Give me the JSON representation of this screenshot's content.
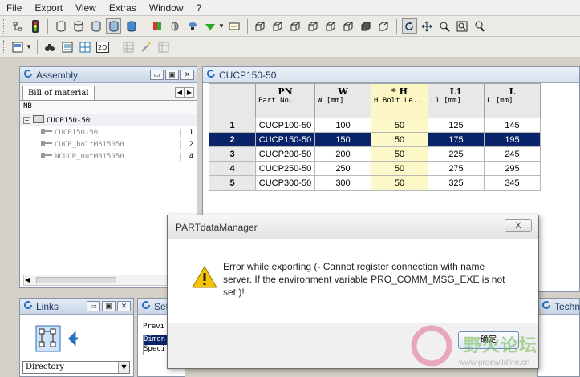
{
  "menubar": {
    "items": [
      "File",
      "Export",
      "View",
      "Extras",
      "Window",
      "?"
    ]
  },
  "assembly": {
    "title": "Assembly",
    "tab": "Bill of material",
    "column_header": "NB",
    "root": "CUCP150-50",
    "items": [
      {
        "name": "CUCP150-50",
        "qty": "1"
      },
      {
        "name": "CUCP_boltM815050",
        "qty": "2"
      },
      {
        "name": "NCUCP_nutM815050",
        "qty": "4"
      }
    ]
  },
  "table_window": {
    "title": "CUCP150-50",
    "columns": [
      {
        "top": "PN",
        "sub": "Part No."
      },
      {
        "top": "W",
        "sub": "W [mm]"
      },
      {
        "top": "* H",
        "sub": "H Bolt Le..."
      },
      {
        "top": "L1",
        "sub": "L1 [mm]"
      },
      {
        "top": "L",
        "sub": "L [mm]"
      }
    ],
    "rows": [
      {
        "no": "1",
        "cells": [
          "CUCP100-50",
          "100",
          "50",
          "125",
          "145"
        ]
      },
      {
        "no": "2",
        "cells": [
          "CUCP150-50",
          "150",
          "50",
          "175",
          "195"
        ]
      },
      {
        "no": "3",
        "cells": [
          "CUCP200-50",
          "200",
          "50",
          "225",
          "245"
        ]
      },
      {
        "no": "4",
        "cells": [
          "CUCP250-50",
          "250",
          "50",
          "275",
          "295"
        ]
      },
      {
        "no": "5",
        "cells": [
          "CUCP300-50",
          "300",
          "50",
          "325",
          "345"
        ]
      }
    ],
    "selected_row": "2"
  },
  "links": {
    "title": "Links",
    "dropdown_value": "Directory"
  },
  "set_panel": {
    "title": "Set",
    "label": "Previ",
    "items": [
      "Dimen",
      "Speci"
    ]
  },
  "tech_panel": {
    "title": "Techn"
  },
  "dialog": {
    "title": "PARTdataManager",
    "close": "X",
    "message": "Error while exporting (- Cannot register connection with name server. If the environment variable PRO_COMM_MSG_EXE is not set )!",
    "ok_label": "确定"
  },
  "watermark": {
    "text": "野火论坛",
    "url": "www.proewildfire.cn"
  },
  "colors": {
    "selection": "#0a246a",
    "highlight_column": "#fdf8c8",
    "panel_title": "#1e3a5f"
  }
}
